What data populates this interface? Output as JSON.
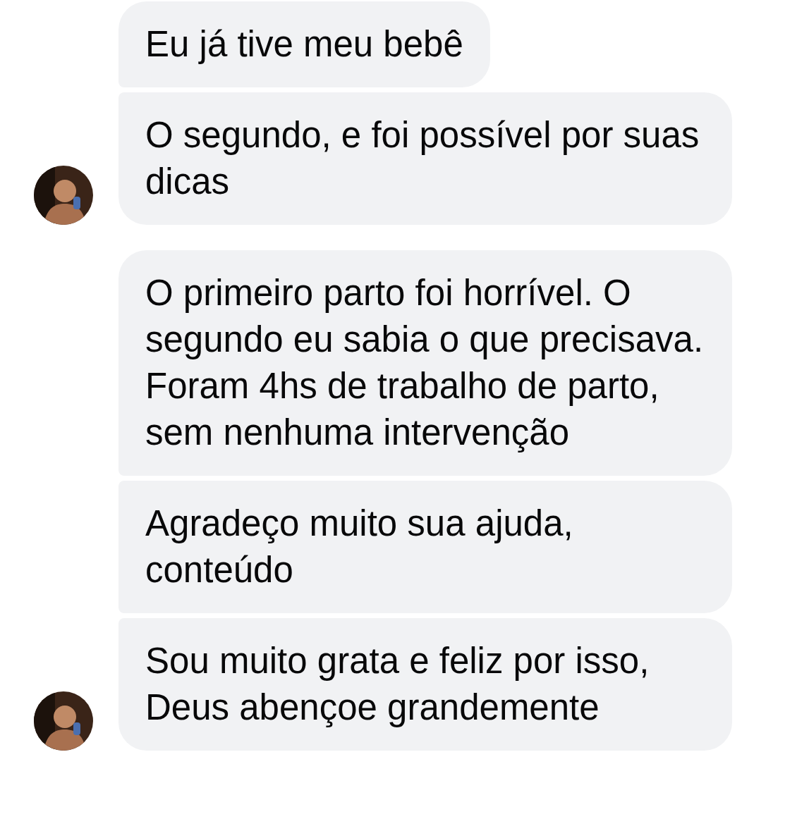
{
  "groups": [
    {
      "avatar": true,
      "messages": [
        {
          "text": "Eu já tive meu bebê"
        },
        {
          "text": "O segundo, e foi possível por suas dicas"
        }
      ]
    },
    {
      "avatar": true,
      "messages": [
        {
          "text": "O primeiro parto foi horrível. O segundo eu sabia o que precisava. Foram 4hs de trabalho de parto, sem nenhuma intervenção"
        },
        {
          "text": "Agradeço muito sua ajuda, conteúdo"
        },
        {
          "text": "Sou muito grata e feliz por isso, Deus abençoe grandemente"
        }
      ]
    }
  ]
}
